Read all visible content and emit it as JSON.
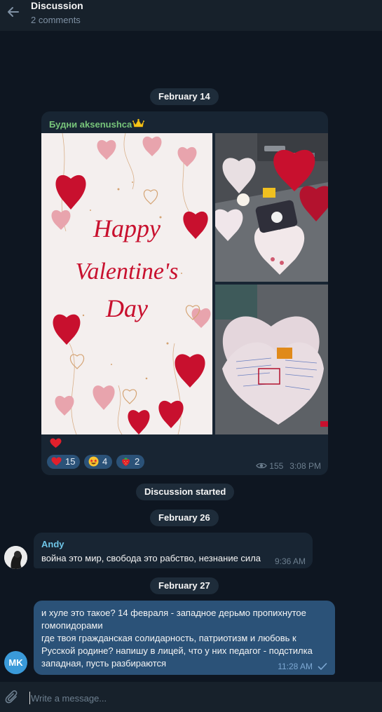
{
  "header": {
    "back_icon": "arrow-left-icon",
    "title": "Discussion",
    "subtitle": "2 comments"
  },
  "dates": {
    "feb14": "February 14",
    "discussion_started": "Discussion started",
    "feb26": "February 26",
    "feb27": "February 27"
  },
  "post": {
    "channel": "Будни aksenushca",
    "channel_badge_icon": "crown-emoji",
    "image_main_text": [
      "Happy",
      "Valentine's",
      "Day"
    ],
    "caption_emoji": "red-heart-emoji",
    "reactions": [
      {
        "icon": "red-heart-emoji",
        "count": "15"
      },
      {
        "icon": "star-struck-emoji",
        "count": "4"
      },
      {
        "icon": "strawberry-emoji",
        "count": "2"
      }
    ],
    "views": "155",
    "time": "3:08 PM"
  },
  "messages": [
    {
      "author": "Andy",
      "avatar_icon": "avatar-andy",
      "text": "война это мир, свобода это рабство, незнание сила",
      "time": "9:36 AM"
    },
    {
      "avatar_initials": "MK",
      "text_lines": [
        "и хуле это такое? 14 февраля - западное дерьмо пропихнутое",
        "гомопидорами",
        "где твоя гражданская солидарность, патриотизм и любовь к",
        "Русской родине? напишу в лицей, что у них педагог - подстилка",
        "западная, пусть разбираются"
      ],
      "time": "11:28 AM",
      "status_icon": "check-icon"
    }
  ],
  "composer": {
    "attach_icon": "paperclip-icon",
    "placeholder": "Write a message...",
    "value": ""
  },
  "colors": {
    "background": "#0e1621",
    "header": "#17212b",
    "bubble_in": "#182533",
    "bubble_out": "#2b5278",
    "channel_name": "#77c47a",
    "author_name": "#6fc6e8"
  }
}
